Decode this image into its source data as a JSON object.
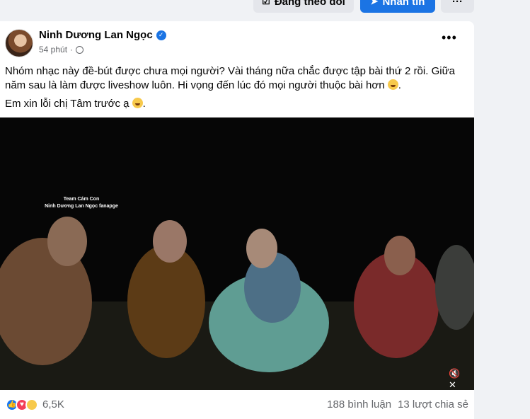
{
  "top_actions": {
    "follow_label": "Đang theo dõi",
    "message_label": "Nhắn tin",
    "more_label": "···"
  },
  "post": {
    "author": "Ninh Dương Lan Ngọc",
    "time": "54 phút",
    "menu": "•••",
    "paragraphs": [
      "Nhóm nhạc này đề-bút được chưa mọi người? Vài tháng nữa chắc được tập bài thứ 2 rồi. Giữa năm sau là làm được liveshow luôn. Hi vọng đến lúc đó mọi người thuộc bài hơn",
      "Em xin lỗi chị Tâm trước ạ"
    ],
    "video_caption_line1": "Team Cám Con",
    "video_caption_line2": "Ninh Dương Lan Ngọc fanapge",
    "reaction_count": "6,5K",
    "comments": "188 bình luận",
    "shares": "13 lượt chia sẻ"
  },
  "icons": [
    "check-icon",
    "messenger-icon",
    "more-icon",
    "verified-icon",
    "globe-icon",
    "mute-icon",
    "like-icon",
    "love-icon",
    "haha-icon"
  ],
  "colors": {
    "accent": "#1b74e4",
    "background": "#f0f2f5",
    "card": "#ffffff",
    "muted": "#65676b"
  }
}
